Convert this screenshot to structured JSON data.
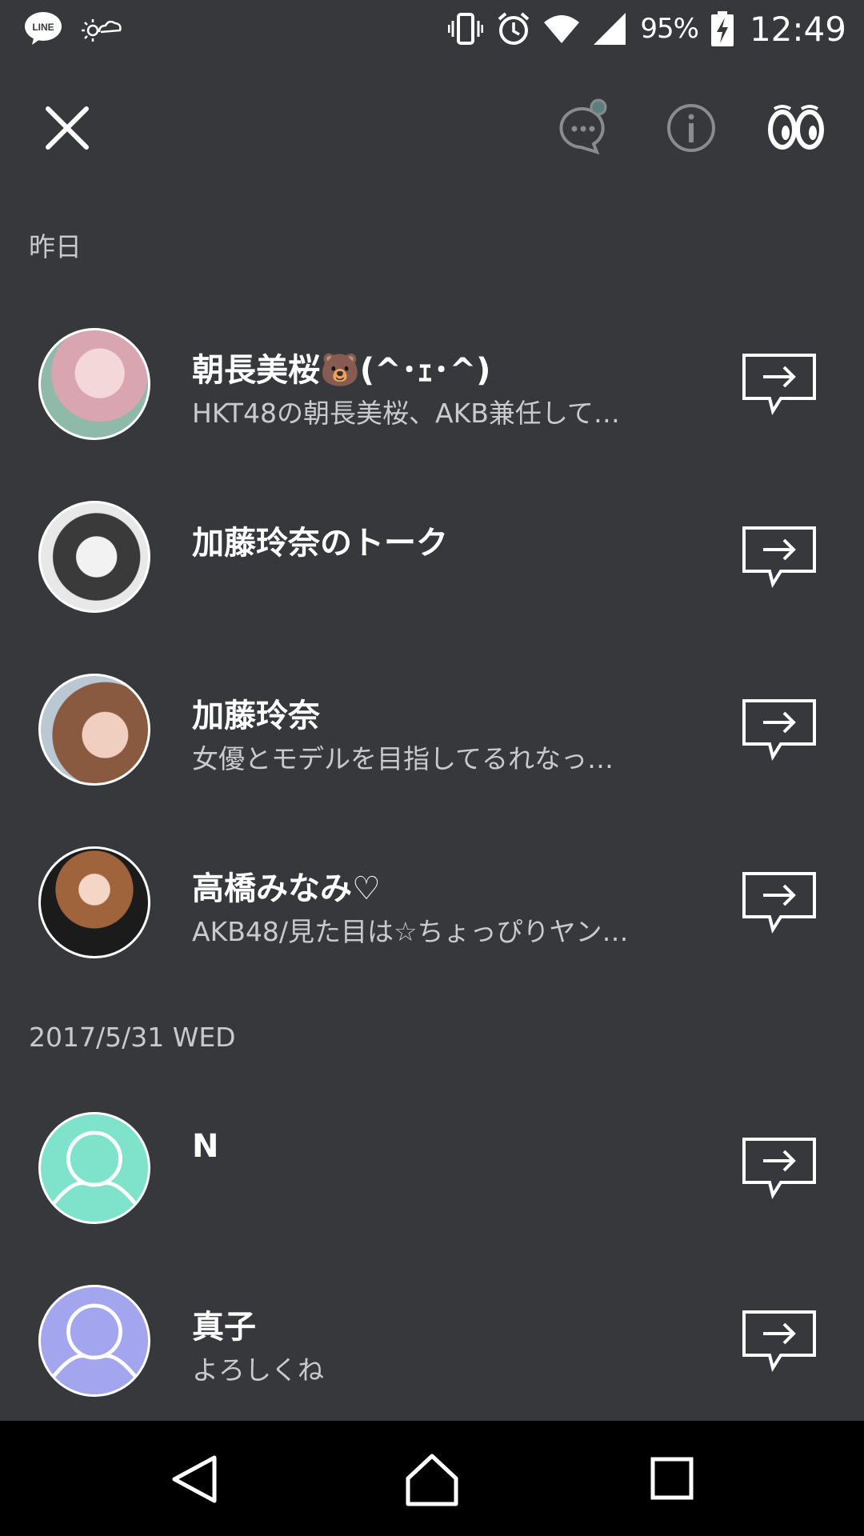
{
  "status_bar": {
    "battery_percent": "95%",
    "time": "12:49",
    "icons": [
      "line-app-icon",
      "weather-icon",
      "vibrate-icon",
      "alarm-icon",
      "wifi-icon",
      "signal-icon",
      "battery-charging-icon"
    ]
  },
  "header": {
    "icons": [
      "close-icon",
      "chat-bubble-icon",
      "info-icon",
      "eyes-icon"
    ]
  },
  "sections": [
    {
      "label": "昨日",
      "items": [
        {
          "name": "朝長美桜🐻(^･ｪ･^)",
          "subtitle": "HKT48の朝長美桜、AKB兼任して…",
          "avatar_color": "#d9a5b0"
        },
        {
          "name": "加藤玲奈のトーク",
          "subtitle": "",
          "avatar_color": "#b5b5b5"
        },
        {
          "name": "加藤玲奈",
          "subtitle": "女優とモデルを目指してるれなっ…",
          "avatar_color": "#b07a5c"
        },
        {
          "name": "高橋みなみ♡",
          "subtitle": "AKB48/見た目は☆ちょっぴりヤン…",
          "avatar_color": "#6b4a3a"
        }
      ]
    },
    {
      "label": "2017/5/31 WED",
      "items": [
        {
          "name": "N",
          "subtitle": "",
          "avatar_color": "#7fe3cc"
        },
        {
          "name": "真子",
          "subtitle": "よろしくね",
          "avatar_color": "#a3a5ef"
        }
      ]
    }
  ],
  "colors": {
    "background": "#37383b",
    "nav_bar": "#000000",
    "default_avatar_teal": "#7fe3cc",
    "default_avatar_purple": "#a3a5ef"
  }
}
